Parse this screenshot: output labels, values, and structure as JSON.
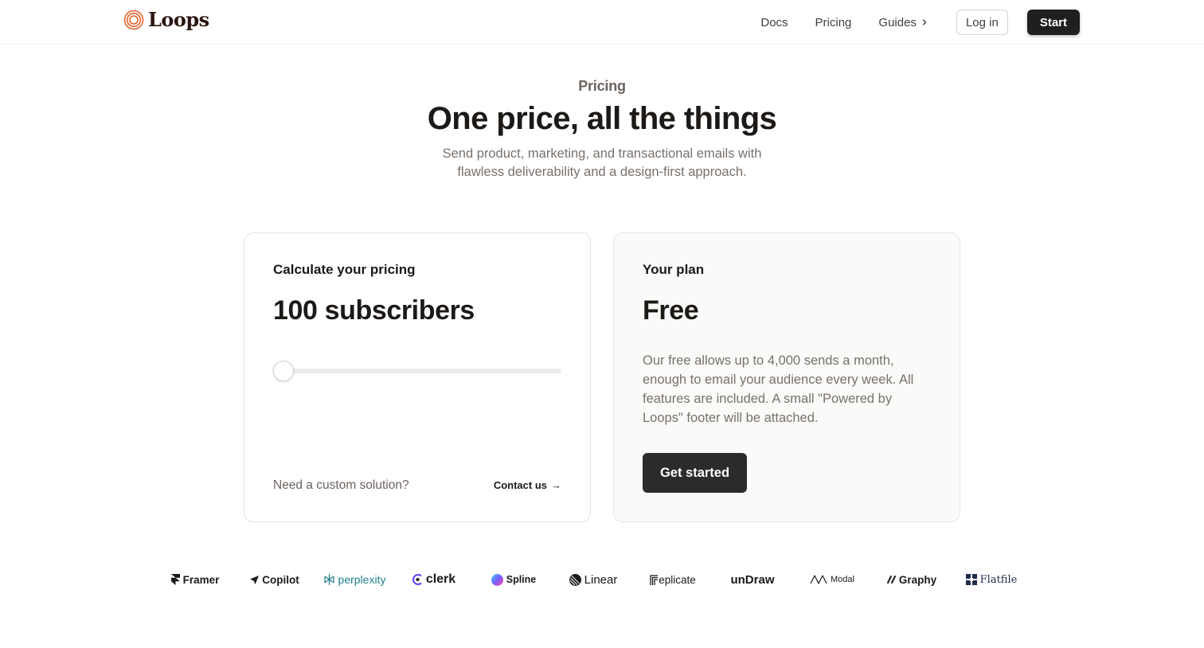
{
  "header": {
    "brand": "Loops",
    "nav": {
      "docs": "Docs",
      "pricing": "Pricing",
      "guides": "Guides"
    },
    "login_label": "Log in",
    "start_label": "Start"
  },
  "hero": {
    "eyebrow": "Pricing",
    "title": "One price, all the things",
    "subtitle": "Send product, marketing, and transactional emails with flawless deliverability and a design-first approach."
  },
  "calculator": {
    "label": "Calculate your pricing",
    "subscribers": "100 subscribers",
    "slider_fraction": 0,
    "custom_text": "Need a custom solution?",
    "contact_label": "Contact us",
    "contact_arrow": "→"
  },
  "plan": {
    "label": "Your plan",
    "name": "Free",
    "description": "Our free allows up to 4,000 sends a month, enough to email your audience every week. All features are included. A small \"Powered by Loops\" footer will be attached.",
    "cta_label": "Get started"
  },
  "customer_logos": {
    "framer": "Framer",
    "copilot": "Copilot",
    "perplexity": "perplexity",
    "clerk": "clerk",
    "spline": "Spline",
    "linear": "Linear",
    "replicate": "eplicate",
    "undraw": "unDraw",
    "modal": "Modal",
    "graphy": "Graphy",
    "flatfile": "Flatfile"
  },
  "colors": {
    "brand_orange": "#e8622a",
    "dark_button": "#1f1f1f",
    "muted_text": "#78716c",
    "card_alt_bg": "#fafaf9"
  }
}
